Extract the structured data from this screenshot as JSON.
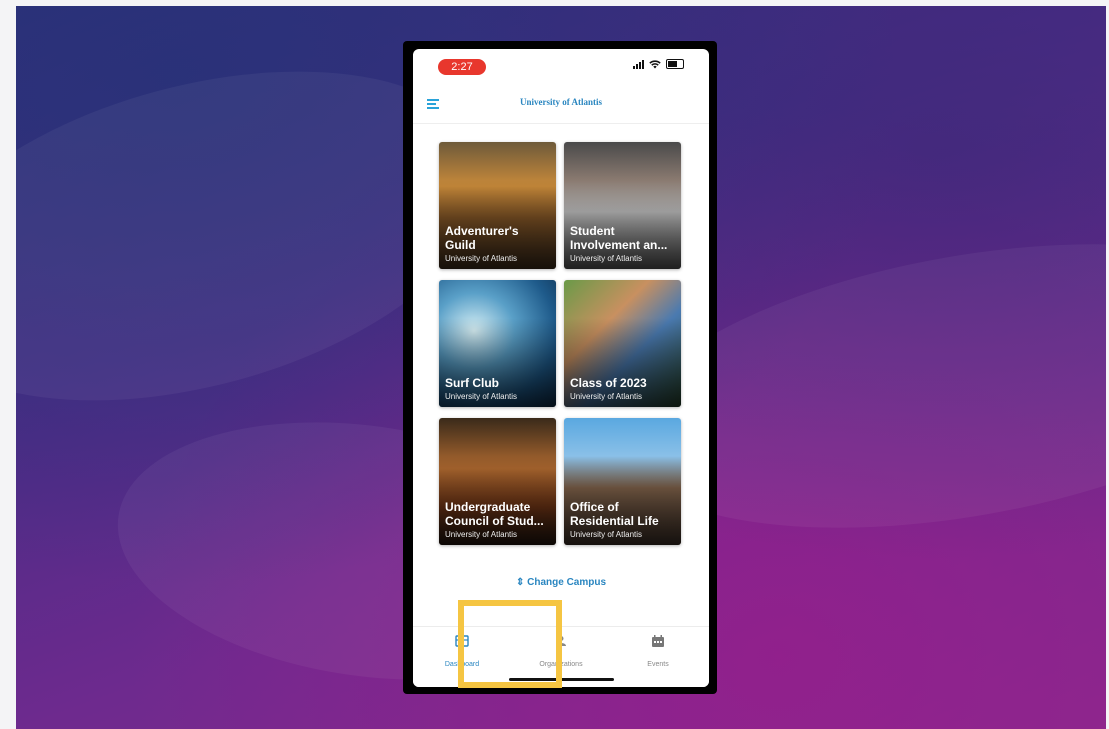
{
  "status_bar": {
    "time": "2:27"
  },
  "app_bar": {
    "title": "University of Atlantis"
  },
  "organizations": [
    {
      "name": "Adventurer's\nGuild",
      "campus": "University of Atlantis",
      "icon": "forest-photo"
    },
    {
      "name": "Student\nInvolvement an...",
      "campus": "University of Atlantis",
      "icon": "campus-event-photo"
    },
    {
      "name": "Surf Club",
      "campus": "University of Atlantis",
      "icon": "wave-photo"
    },
    {
      "name": "Class of 2023",
      "campus": "University of Atlantis",
      "icon": "hands-map-photo"
    },
    {
      "name": "Undergraduate\nCouncil of Stud...",
      "campus": "University of Atlantis",
      "icon": "gavel-photo"
    },
    {
      "name": "Office of\nResidential Life",
      "campus": "University of Atlantis",
      "icon": "dormitory-photo"
    }
  ],
  "change_campus": "⇕ Change Campus",
  "tabs": [
    {
      "label": "Dashboard",
      "icon": "dashboard-icon",
      "active": true
    },
    {
      "label": "Organizations",
      "icon": "organizations-icon",
      "active": false
    },
    {
      "label": "Events",
      "icon": "calendar-icon",
      "active": false
    }
  ],
  "colors": {
    "accent": "#2a86c0",
    "highlight": "#f5c542",
    "time_pill": "#e8372d"
  }
}
